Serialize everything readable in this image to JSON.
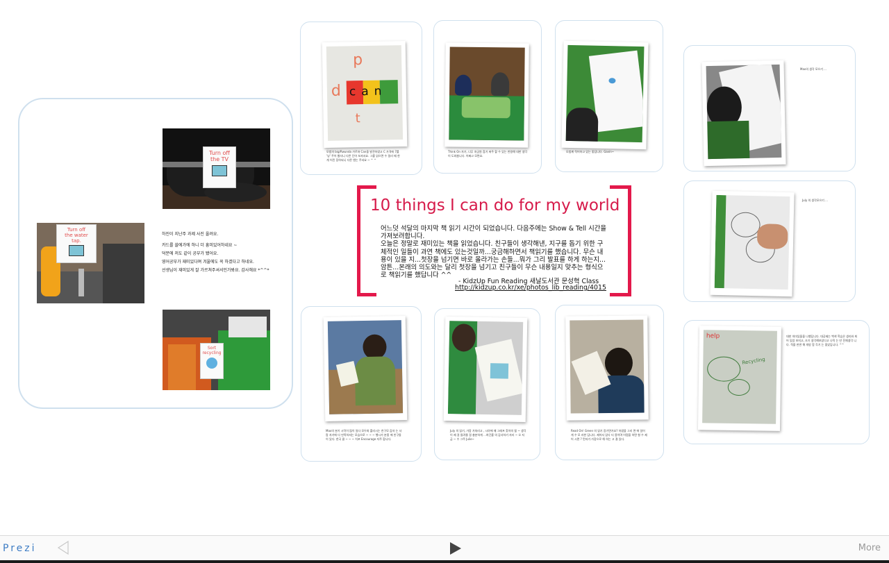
{
  "title": "10 things I can do for my world",
  "body": "어느덧 석달의 마지막 책 읽기 시간이 되었습니다. 다음주에는 Show & Tell 시간을\n가져보려합니다.\n오늘은 정말로 재미있는 책을 읽었습니다. 친구들이 생각해낸, 지구를 돕기 위한 구\n체적인 일들이 과연 책에도 있는것일까...궁금해하면서 책읽기를 했습니다. 무슨 내\n용이 있을 지...첫장을 넘기면 바로 올라가는 손들...뭐가 그리 발표를 하게 하는지...\n암튼...본래의 의도와는 달리 첫장을 넘기고 친구들이 무슨 내용일지 맞추는 형식으\n로 책읽기를 했답니다 ^^",
  "credit": "-  KidzUp Fun Reading 새날도서관 문성혁 Class",
  "link": "http://kidzup.co.kr/xe/photos_lib_reading/4015",
  "left_note": {
    "lines": [
      "하진이 지난주 과제 사진 올려요.",
      "카드를 쓸에가에 하니 더 흥미있어하네요 ~",
      "덕분에 저도 같이 공부가 됐어요.",
      "영어공부가 재미있다며 겨울에도 꼭 하겠다고 하네요.",
      "선생님이 재미있게 잘 가르쳐주셔서인가봐요. 감사해요 *^^*"
    ]
  },
  "left_photos": {
    "tv_sign": [
      "Turn off",
      "the TV"
    ],
    "water_sign": [
      "Turn off",
      "the water",
      "tap."
    ],
    "sort_sign": [
      "Sort",
      "recycling"
    ]
  },
  "board_letters": {
    "p": "p",
    "d": "d",
    "can": "can",
    "t": "t"
  },
  "captions": {
    "c1": "모범의 big/Rwunda 가르쳐 Can을 발견하였고 C 가격에 7를 '낭' 주어 봤더니 다른 단어 보셔서요. 그를 읽으면 수 밀리 때 한 게 어린 장하되니 다른 앤는 주셔요 ~ ^ ^",
    "c2": "Think On 자기, 너무 처궁원 참기 써주 할 수 있는 천왕해 대한 생각이 도와봅니다. 어쩌고 모면요.",
    "c3": "모범께 적어하고 있는 좋답니다. Gavin~",
    "c4": "Max의 생각 모으기 ...",
    "c5": "July 의 생각모으기 ...",
    "c6": "Max의 분기 시작이 많이 일다 모두와 폴리시는 친구모 감자 는 사람 자기에 다 만족하셔는 모습으로 ~ ~ ~ 행시가 분중 에 친구들이 있다. 한국 클 ~ ~ ~ 치포 Encourage 자주 합니다.",
    "c7": "July 의 읽기, 가장 가처리고 , 시야에 때 그레프 찾아의 될 ~ 생각이 제 걸 들려줄 걸 충분하게 ...여긴를 의 감사하기 자리 ~ 오 지금 ~ 수 그주 Julie~",
    "c8": "Read On! Green 의 읽기 장기면가요? 하였을 그리 면 에 일어 게 수 모 라한 답니다. 제어서 있다 더 용이며 어렵을 하면 형 수 제어 시면 ? 먼저가 가장으로 해 하는 고 결 있다.",
    "c9": "대한 의미있을을 나했답니다. 대공제는 백색 학습은 생리와 최어 있었 보지고, 조기 생각해보았다고 나적 는 만 전체생각 니다. 적을 판관 해 개방 함 각기 는 좋았답니다. ^^",
    "c9_words": {
      "help": "help",
      "recycling": "Recycling"
    }
  },
  "bottom": {
    "logo": "Prezi",
    "more": "More"
  },
  "colors": {
    "accent": "#e3194b",
    "frame": "#cfe0ee",
    "logo": "#3d7cc4"
  }
}
